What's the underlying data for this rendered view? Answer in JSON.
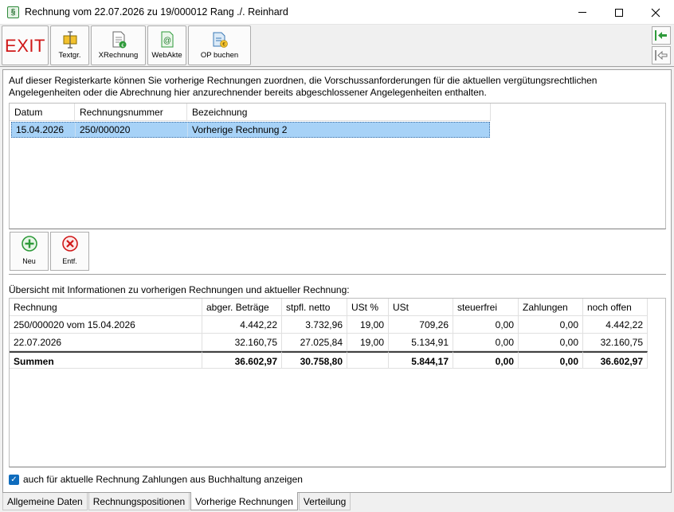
{
  "window": {
    "title": "Rechnung vom 22.07.2026 zu 19/000012 Rang ./. Reinhard",
    "app_icon_glyph": "§"
  },
  "toolbar": {
    "exit_label": "EXIT",
    "buttons": [
      {
        "label": "Textgr.",
        "icon": "text-block-icon"
      },
      {
        "label": "XRechnung",
        "icon": "xrechnung-document-icon"
      },
      {
        "label": "WebAkte",
        "icon": "webakte-icon"
      },
      {
        "label": "OP buchen",
        "icon": "op-book-icon"
      }
    ]
  },
  "intro_text": "Auf dieser Registerkarte können Sie vorherige Rechnungen zuordnen, die Vorschussanforderungen für die aktuellen vergütungsrechtlichen Angelegenheiten oder die Abrechnung hier anzurechnender bereits abgeschlossener Angelegenheiten enthalten.",
  "previous_invoices": {
    "columns": [
      "Datum",
      "Rechnungsnummer",
      "Bezeichnung"
    ],
    "rows": [
      {
        "datum": "15.04.2026",
        "nummer": "250/000020",
        "bezeichnung": "Vorherige Rechnung 2"
      }
    ]
  },
  "list_buttons": {
    "new_label": "Neu",
    "remove_label": "Entf."
  },
  "overview": {
    "title": "Übersicht mit Informationen zu vorherigen Rechnungen und aktueller Rechnung:",
    "columns": [
      "Rechnung",
      "abger. Beträge",
      "stpfl. netto",
      "USt %",
      "USt",
      "steuerfrei",
      "Zahlungen",
      "noch offen"
    ],
    "rows": [
      [
        "250/000020 vom 15.04.2026",
        "4.442,22",
        "3.732,96",
        "19,00",
        "709,26",
        "0,00",
        "0,00",
        "4.442,22"
      ],
      [
        "22.07.2026",
        "32.160,75",
        "27.025,84",
        "19,00",
        "5.134,91",
        "0,00",
        "0,00",
        "32.160,75"
      ]
    ],
    "sum_row": [
      "Summen",
      "36.602,97",
      "30.758,80",
      "",
      "5.844,17",
      "0,00",
      "0,00",
      "36.602,97"
    ]
  },
  "checkbox": {
    "label": "auch für aktuelle Rechnung Zahlungen aus Buchhaltung anzeigen",
    "checked": true
  },
  "tabs": [
    {
      "label": "Allgemeine Daten",
      "active": false
    },
    {
      "label": "Rechnungspositionen",
      "active": false
    },
    {
      "label": "Vorherige Rechnungen",
      "active": true
    },
    {
      "label": "Verteilung",
      "active": false
    }
  ],
  "colors": {
    "selection": "#a7d2f7",
    "exit_red": "#d01818",
    "checkbox_blue": "#0f6cbd",
    "nav_green": "#2e9a3a"
  }
}
